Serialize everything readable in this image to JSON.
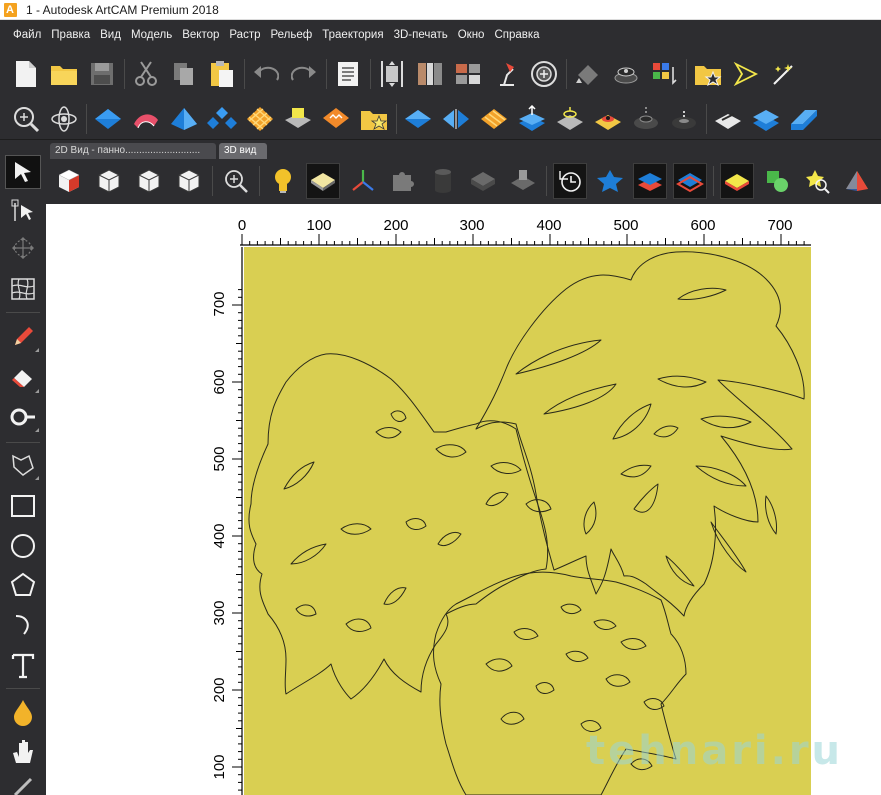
{
  "window": {
    "title": "1 - Autodesk ArtCAM Premium 2018",
    "logo_letter": "A"
  },
  "menu": [
    "Файл",
    "Правка",
    "Вид",
    "Модель",
    "Вектор",
    "Растр",
    "Рельеф",
    "Траектория",
    "3D-печать",
    "Окно",
    "Справка"
  ],
  "tabs": {
    "tab_2d": "2D Вид - панно...........................",
    "tab_3d": "3D вид"
  },
  "ruler": {
    "x_labels": [
      "0",
      "100",
      "200",
      "300",
      "400",
      "500",
      "600",
      "700"
    ],
    "y_labels": [
      "700",
      "600",
      "500",
      "400",
      "300",
      "200",
      "100"
    ]
  },
  "canvas": {
    "background_color": "#d9cf52",
    "outline_color": "#2a2a1a"
  },
  "watermark": {
    "text": "tehnari.ru"
  },
  "toolbar_icons": {
    "row1": [
      "new-file-icon",
      "open-folder-icon",
      "save-icon",
      "cut-icon",
      "copy-icon",
      "paste-icon",
      "undo-icon",
      "redo-icon",
      "notes-icon",
      "model-size-icon",
      "panel-icon",
      "tiles-icon",
      "desk-lamp-icon",
      "render-icon",
      "paint-bucket-icon",
      "relief-layers-icon",
      "color-sort-icon",
      "favorites-folder-icon",
      "vector-arrow-icon",
      "magic-wand-icon"
    ],
    "row2": [
      "zoom-icon",
      "atom-icon",
      "relief-shape-icon",
      "extrude-icon",
      "sweep-icon",
      "build-icon",
      "weave-icon",
      "texture-icon",
      "stamp-icon",
      "favorites-icon",
      "flat-relief-icon",
      "mirror-relief-icon",
      "stripes-relief-icon",
      "raise-relief-icon",
      "blend-relief-icon",
      "offset-relief-icon",
      "dark-relief-icon",
      "stack-relief-icon",
      "relief-tool-icon",
      "relief-layer-icon",
      "blue-relief-icon"
    ],
    "view": [
      "select-icon",
      "cube-iso-icon",
      "cube-front-icon",
      "cube-top-icon",
      "cube-side-icon",
      "zoom-view-icon",
      "light-bulb-icon",
      "material-icon",
      "axis-icon",
      "puzzle-icon",
      "cylinder-icon",
      "box-relief-icon",
      "cut-relief-icon",
      "clock-icon",
      "star-relief-icon",
      "layer-relief-icon",
      "red-layer-icon",
      "yellow-layer-icon",
      "green-shapes-icon",
      "star-zoom-icon",
      "pyramid-icon"
    ],
    "left": [
      "pointer-icon",
      "node-edit-icon",
      "transform-icon",
      "mesh-icon",
      "pencil-icon",
      "eraser-icon",
      "measure-icon",
      "lasso-icon",
      "rectangle-icon",
      "circle-icon",
      "pentagon-icon",
      "arc-icon",
      "text-icon",
      "fill-icon",
      "hand-icon"
    ]
  }
}
